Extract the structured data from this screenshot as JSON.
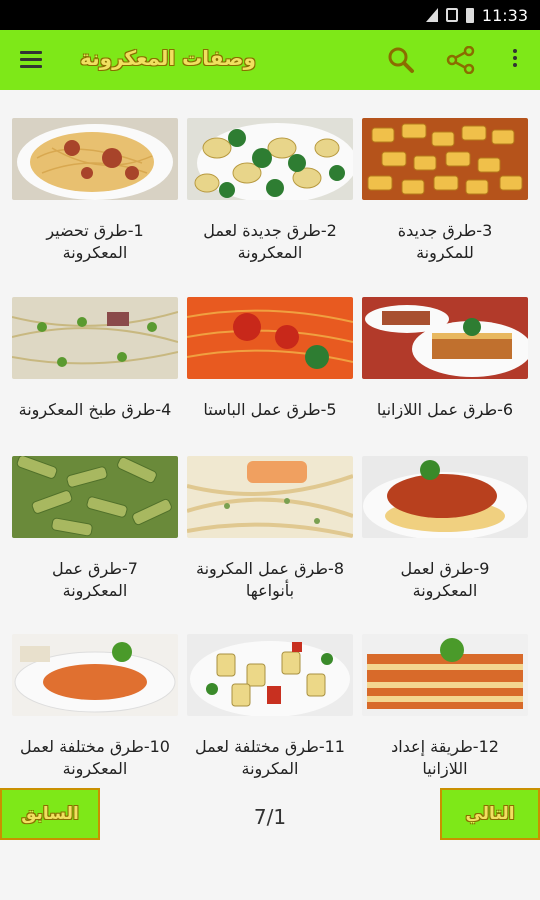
{
  "status_bar": {
    "time": "11:33"
  },
  "toolbar": {
    "title": "وصفات المعكرونة",
    "icons": [
      "menu-icon",
      "search-icon",
      "share-icon",
      "more-icon"
    ]
  },
  "recipes": [
    {
      "label": "1-طرق تحضير المعكرونة",
      "image": "spaghetti-meat-plate"
    },
    {
      "label": "2-طرق جديدة لعمل المعكرونة",
      "image": "fusilli-broccoli-bowl"
    },
    {
      "label": "3-طرق جديدة للمكرونة",
      "image": "rigatoni-cheese"
    },
    {
      "label": "4-طرق طبخ المعكرونة",
      "image": "spaghetti-peas-ham"
    },
    {
      "label": "5-طرق عمل الباستا",
      "image": "spaghetti-tomato-sauce"
    },
    {
      "label": "6-طرق عمل اللازانيا",
      "image": "lasagna-plates"
    },
    {
      "label": "7-طرق عمل المعكرونة",
      "image": "penne-pesto"
    },
    {
      "label": "8-طرق عمل المكرونة بأنواعها",
      "image": "fettuccine-salmon"
    },
    {
      "label": "9-طرق لعمل المعكرونة",
      "image": "spaghetti-bolognese"
    },
    {
      "label": "10-طرق مختلفة لعمل المعكرونة",
      "image": "spaghetti-basil-plate"
    },
    {
      "label": "11-طرق مختلفة لعمل المكرونة",
      "image": "rigatoni-vegetables"
    },
    {
      "label": "12-طريقة إعداد اللازانيا",
      "image": "lasagna-slice"
    }
  ],
  "pagination": {
    "prev_label": "السابق",
    "next_label": "التالي",
    "page_text": "7/1"
  },
  "colors": {
    "accent": "#7ee818",
    "title_text": "#f0e060",
    "button_border": "#c99000"
  }
}
